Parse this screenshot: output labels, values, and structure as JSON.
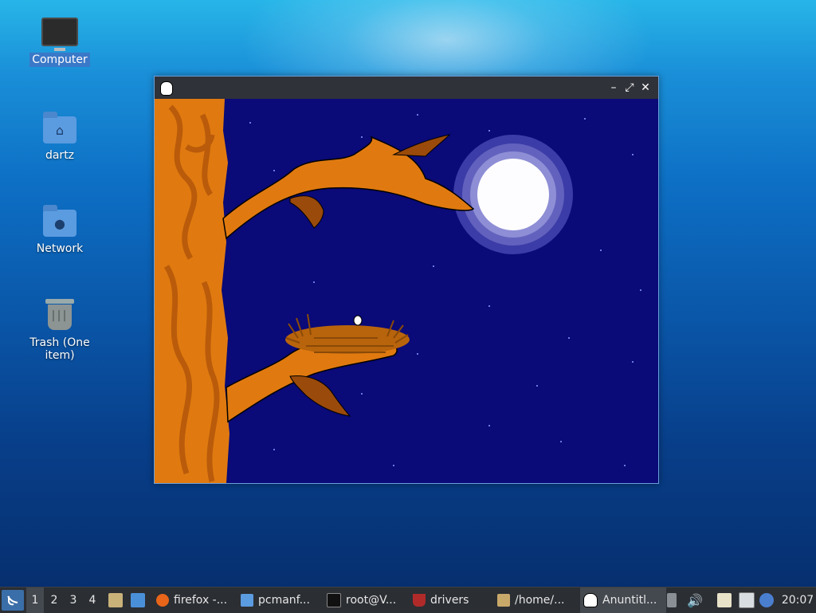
{
  "desktop": {
    "icons": [
      {
        "label": "Computer",
        "icon": "computer-icon"
      },
      {
        "label": "dartz",
        "icon": "home-folder-icon"
      },
      {
        "label": "Network",
        "icon": "network-folder-icon"
      },
      {
        "label": "Trash (One item)",
        "icon": "trash-icon"
      }
    ]
  },
  "window": {
    "icon": "app-icon",
    "buttons": {
      "minimize": "–",
      "maximize": "⤢",
      "close": "✕"
    }
  },
  "taskbar": {
    "workspaces": [
      "1",
      "2",
      "3",
      "4"
    ],
    "tasks": [
      {
        "label": "firefox -...",
        "icon": "firefox-icon"
      },
      {
        "label": "pcmanf...",
        "icon": "folder-icon"
      },
      {
        "label": "root@V...",
        "icon": "terminal-icon"
      },
      {
        "label": "drivers",
        "icon": "wine-icon"
      },
      {
        "label": "/home/...",
        "icon": "archive-icon"
      },
      {
        "label": "Anuntitl...",
        "icon": "app-icon"
      }
    ],
    "clock": "20:07"
  },
  "colors": {
    "sky": "#0a0a78",
    "moon": "#ffffff",
    "tree": "#e07a10",
    "taskbar": "#2b2e33",
    "selection": "#3a78c8"
  }
}
